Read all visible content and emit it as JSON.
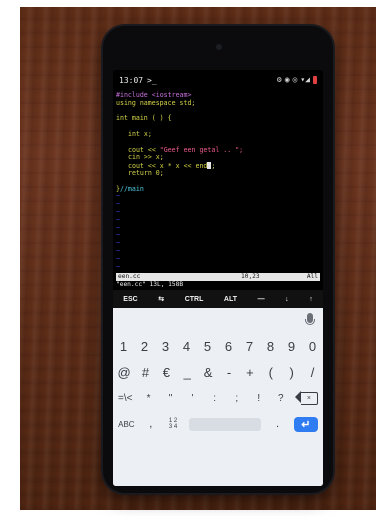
{
  "status_bar": {
    "time": "13:07",
    "app_icon": ">_",
    "icons": [
      "settings-icon",
      "lock-icon",
      "sync-icon",
      "signal-icon",
      "battery-low-icon"
    ]
  },
  "editor": {
    "include_kw": "#include",
    "include_lib": "<iostream>",
    "using_line": "using namespace std;",
    "main_sig": "int main ( ) {",
    "decl": "int x;",
    "cout_kw": "cout << ",
    "cout_str": "\"Geef een getal .. \";",
    "cin_line": "cin >> x;",
    "cout2_prefix": "cout << x * x << end",
    "cout2_suffix": ";",
    "return_line": "return 0;",
    "close_brace": "}",
    "close_comment": "//main",
    "tilde": "~"
  },
  "statusline": {
    "file": "een.cc",
    "position": "10,23",
    "scroll": "All"
  },
  "cmdline": "\"een.cc\" 13L, 158B",
  "extra_keys": [
    "ESC",
    "⇆",
    "CTRL",
    "ALT",
    "—",
    "↓",
    "↑"
  ],
  "keyboard": {
    "row_numbers": [
      "1",
      "2",
      "3",
      "4",
      "5",
      "6",
      "7",
      "8",
      "9",
      "0"
    ],
    "row_symbols1": [
      "@",
      "#",
      "€",
      "_",
      "&",
      "-",
      "+",
      "(",
      ")",
      "/"
    ],
    "row_symbols2": [
      "=\\<",
      "*",
      "\"",
      "'",
      ":",
      ";",
      "!",
      "?"
    ],
    "abc_label": "ABC",
    "comma": ",",
    "fraction_top": "1 2",
    "fraction_bottom": "3 4",
    "period": ".",
    "enter_icon": "↵",
    "backspace_icon": "×"
  }
}
